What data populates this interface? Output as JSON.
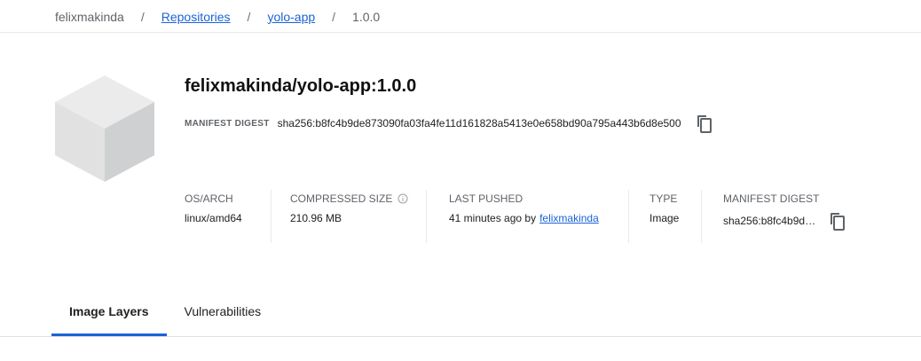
{
  "breadcrumb": {
    "root": "felixmakinda",
    "sep": "/",
    "repositories": "Repositories",
    "repo": "yolo-app",
    "tag": "1.0.0"
  },
  "image": {
    "title": "felixmakinda/yolo-app:1.0.0",
    "digest_label": "MANIFEST DIGEST",
    "digest": "sha256:b8fc4b9de873090fa03fa4fe11d161828a5413e0e658bd90a795a443b6d8e500"
  },
  "meta": {
    "os_arch": {
      "label": "OS/ARCH",
      "value": "linux/amd64"
    },
    "compressed_size": {
      "label": "COMPRESSED SIZE",
      "value": "210.96 MB"
    },
    "last_pushed": {
      "label": "LAST PUSHED",
      "value": "41 minutes ago by",
      "user": "felixmakinda"
    },
    "type": {
      "label": "TYPE",
      "value": "Image"
    },
    "manifest_digest": {
      "label": "MANIFEST DIGEST",
      "value": "sha256:b8fc4b9d…"
    }
  },
  "tabs": [
    {
      "label": "Image Layers",
      "active": true
    },
    {
      "label": "Vulnerabilities",
      "active": false
    }
  ],
  "colors": {
    "link": "#1a63d6",
    "accent": "#1a63d6"
  }
}
